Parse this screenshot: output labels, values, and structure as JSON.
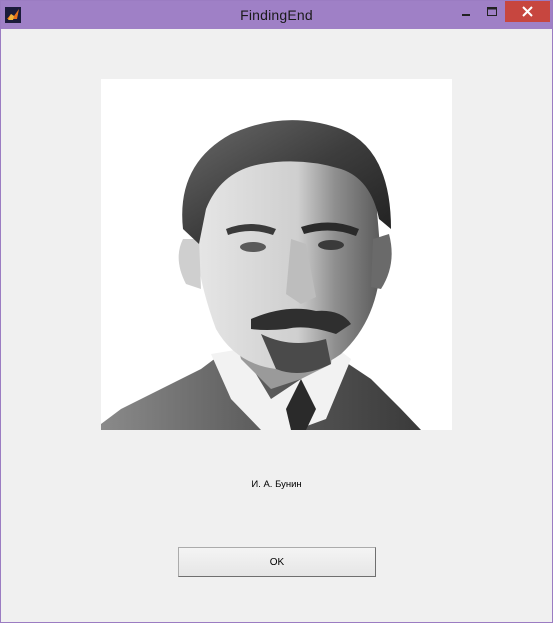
{
  "window": {
    "title": "FindingEnd",
    "app_icon": "matlab-icon",
    "controls": [
      "minimize-icon",
      "maximize-icon",
      "close-icon"
    ],
    "accent_color": "#9f80c6",
    "close_color": "#c7463f"
  },
  "content": {
    "image": "portrait-photo",
    "caption": "И. А. Бунин",
    "ok_label": "OK"
  }
}
